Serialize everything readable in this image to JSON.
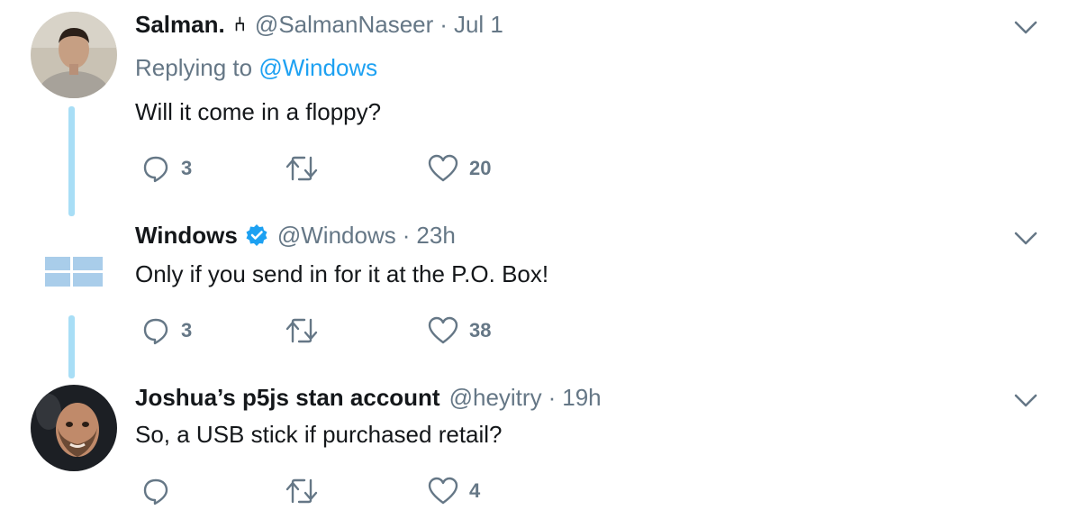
{
  "tweets": [
    {
      "name": "Salman.",
      "badge": "⑃",
      "handle": "@SalmanNaseer",
      "separator": "·",
      "time": "Jul 1",
      "replying_prefix": "Replying to ",
      "replying_to": "@Windows",
      "text": "Will it come in a floppy?",
      "reply_count": "3",
      "retweet_count": "",
      "like_count": "20",
      "verified": false,
      "avatar": "user-photo-avatar"
    },
    {
      "name": "Windows",
      "handle": "@Windows",
      "separator": "·",
      "time": "23h",
      "text": "Only if you send in for it at the P.O. Box!",
      "reply_count": "3",
      "retweet_count": "",
      "like_count": "38",
      "verified": true,
      "avatar": "windows-logo-avatar"
    },
    {
      "name": "Joshua’s p5js stan account",
      "handle": "@heyitry",
      "separator": "·",
      "time": "19h",
      "text": "So, a USB stick if purchased retail?",
      "reply_count": "",
      "retweet_count": "",
      "like_count": "4",
      "verified": false,
      "avatar": "user-photo-avatar"
    }
  ],
  "colors": {
    "text": "#14171a",
    "muted": "#657786",
    "link": "#1da1f2",
    "thread": "#a8def6",
    "verified": "#1da1f2",
    "windows_logo": "#a9cdea"
  },
  "icons": {
    "reply": "reply-icon",
    "retweet": "retweet-icon",
    "like": "heart-icon",
    "menu": "chevron-down-icon",
    "verified": "verified-badge-icon"
  }
}
